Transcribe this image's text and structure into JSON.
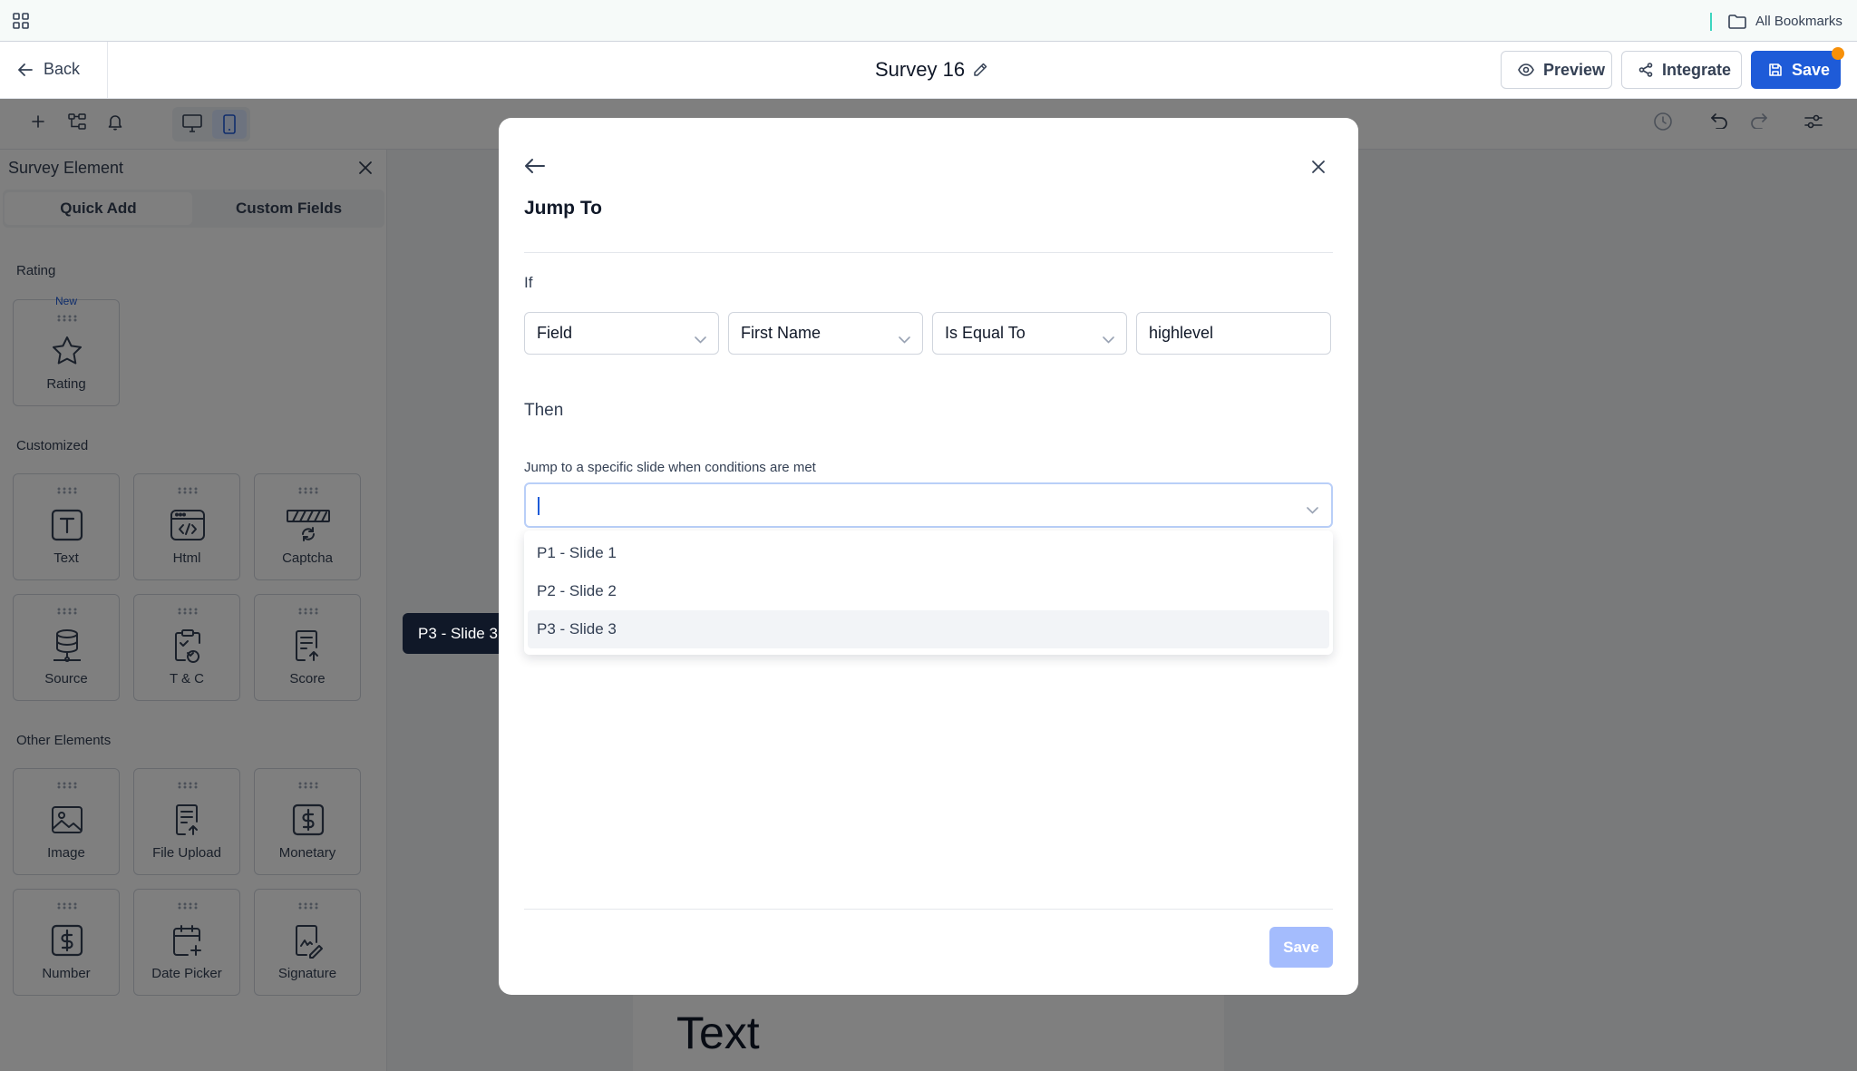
{
  "bookmarks_bar": {
    "all_bookmarks_label": "All Bookmarks"
  },
  "header": {
    "back_label": "Back",
    "survey_title": "Survey 16",
    "preview_label": "Preview",
    "integrate_label": "Integrate",
    "save_label": "Save"
  },
  "sidebar": {
    "title": "Survey Element",
    "tabs": [
      {
        "label": "Quick Add"
      },
      {
        "label": "Custom Fields"
      }
    ],
    "sections": {
      "rating": {
        "label": "Rating",
        "items": [
          {
            "label": "Rating",
            "badge": "New",
            "icon": "star-icon"
          }
        ]
      },
      "customized": {
        "label": "Customized",
        "items": [
          {
            "label": "Text",
            "icon": "text-icon"
          },
          {
            "label": "Html",
            "icon": "html-icon"
          },
          {
            "label": "Captcha",
            "icon": "captcha-icon"
          },
          {
            "label": "Source",
            "icon": "database-icon"
          },
          {
            "label": "T & C",
            "icon": "clipboard-check-icon"
          },
          {
            "label": "Score",
            "icon": "score-icon"
          }
        ]
      },
      "other": {
        "label": "Other Elements",
        "items": [
          {
            "label": "Image",
            "icon": "image-icon"
          },
          {
            "label": "File Upload",
            "icon": "file-upload-icon"
          },
          {
            "label": "Monetary",
            "icon": "dollar-icon"
          },
          {
            "label": "Number",
            "icon": "number-icon"
          },
          {
            "label": "Date Picker",
            "icon": "calendar-plus-icon"
          },
          {
            "label": "Signature",
            "icon": "signature-icon"
          }
        ]
      }
    }
  },
  "canvas": {
    "text_element": "Text"
  },
  "modal": {
    "title": "Jump To",
    "if_label": "If",
    "condition": {
      "field_type": "Field",
      "field_name": "First Name",
      "operator": "Is Equal To",
      "value": "highlevel"
    },
    "then_label": "Then",
    "jump_help": "Jump to a specific slide when conditions are met",
    "jump_value": "",
    "options": [
      {
        "label": "P1 - Slide 1"
      },
      {
        "label": "P2 - Slide 2"
      },
      {
        "label": "P3 - Slide 3"
      }
    ],
    "save_label": "Save"
  },
  "tooltip": {
    "text": "P3 - Slide 3"
  },
  "colors": {
    "accent": "#1e5bd8",
    "notification": "#f79009",
    "save_disabled": "#a4bcfd"
  }
}
